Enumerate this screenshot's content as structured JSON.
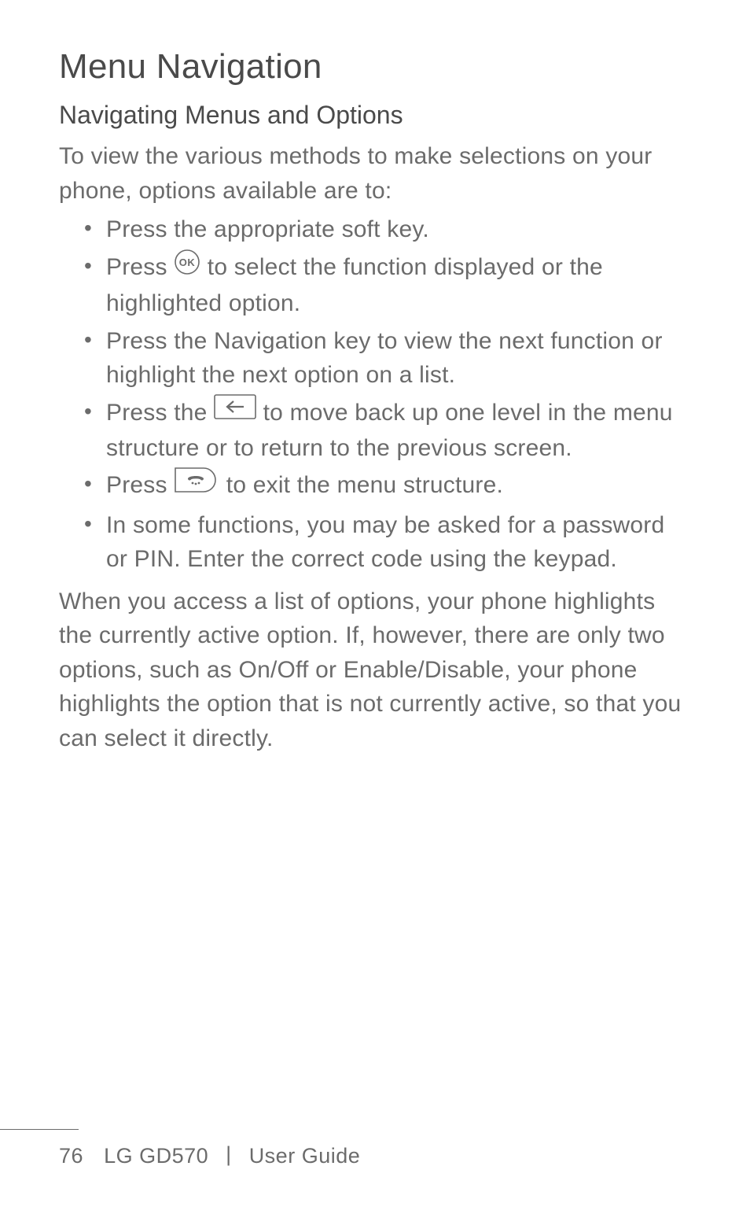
{
  "title": "Menu Navigation",
  "subtitle": "Navigating Menus and Options",
  "intro": "To view the various methods to make selections on your phone, options available are to:",
  "bullets": {
    "b1": "Press the appropriate soft key.",
    "b2a": "Press ",
    "b2b": " to select the function displayed or the highlighted option.",
    "b3": "Press the Navigation key to view the next function or highlight the next option on a list.",
    "b4a": "Press the ",
    "b4b": " to move back up one level in the menu structure or to return to the previous screen.",
    "b5a": "Press ",
    "b5b": " to exit the menu structure.",
    "b6": "In some functions, you may be asked for a password or PIN. Enter the correct code using the keypad."
  },
  "outro": "When you access a list of options, your phone highlights the currently active option. If, however, there are only two options, such as On/Off or Enable/Disable, your phone highlights the option that is not currently active, so that you can select it directly.",
  "footer": {
    "page": "76",
    "product": "LG GD570",
    "separator": "|",
    "doc": "User Guide"
  }
}
